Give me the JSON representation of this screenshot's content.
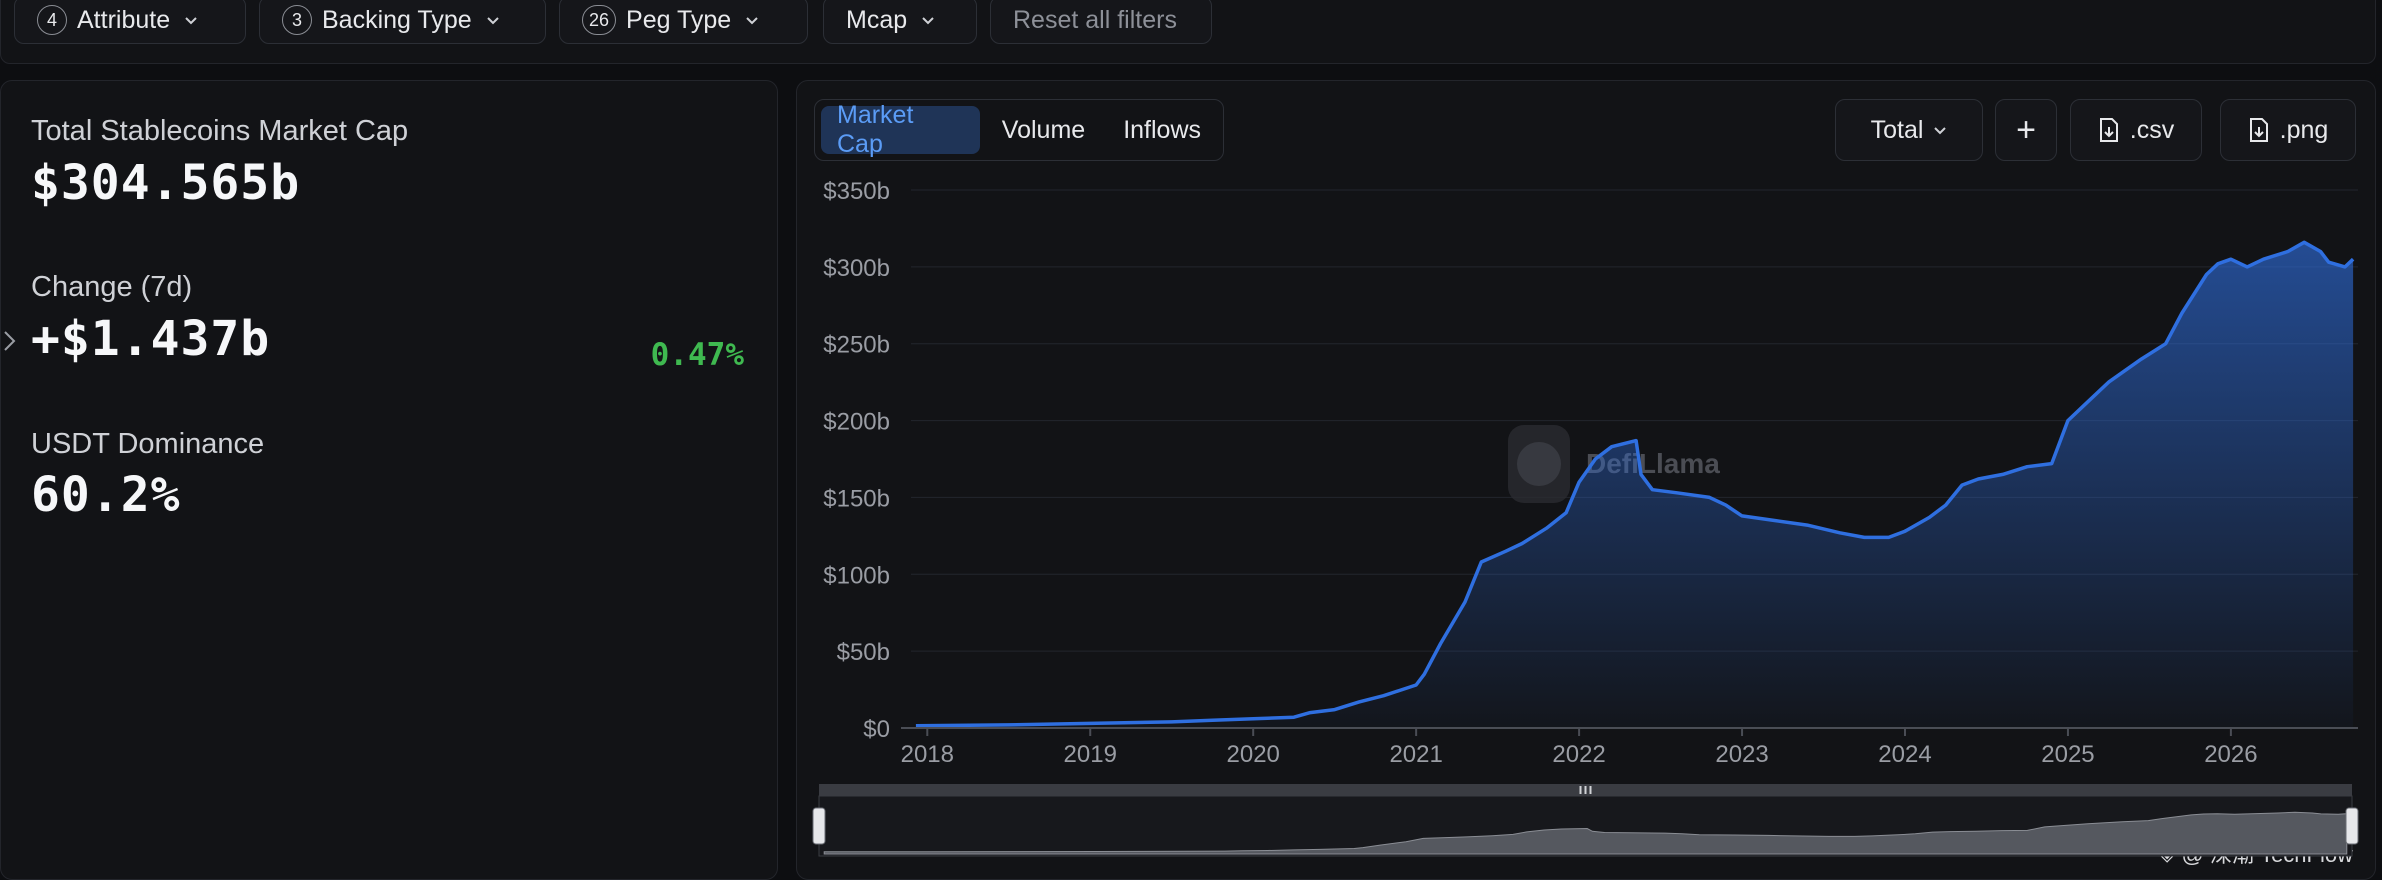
{
  "filters": [
    {
      "count": "4",
      "label": "Attribute"
    },
    {
      "count": "3",
      "label": "Backing Type"
    },
    {
      "count": "26",
      "label": "Peg Type"
    },
    {
      "count": "",
      "label": "Mcap"
    }
  ],
  "reset_label": "Reset all filters",
  "stats": {
    "total_label": "Total Stablecoins Market Cap",
    "total_value": "$304.565b",
    "change_label": "Change (7d)",
    "change_value": "+$1.437b",
    "change_pct": "0.47%",
    "dominance_label": "USDT Dominance",
    "dominance_value": "60.2%"
  },
  "tabs": [
    "Market Cap",
    "Volume",
    "Inflows"
  ],
  "active_tab": "Market Cap",
  "controls": {
    "total_select": "Total",
    "add_label": "+",
    "csv_label": ".csv",
    "png_label": ".png"
  },
  "watermark": "DefiLlama",
  "source_credit": "@ 深潮 TechFlow",
  "colors": {
    "accent": "#2f6fe0",
    "positive": "#3fb950",
    "background": "#121316"
  },
  "chart_data": {
    "type": "area",
    "title": "",
    "xlabel": "",
    "ylabel": "",
    "ylim": [
      0,
      350
    ],
    "y_unit": "b",
    "y_ticks": [
      "$0",
      "$50b",
      "$100b",
      "$150b",
      "$200b",
      "$250b",
      "$300b",
      "$350b"
    ],
    "x_ticks": [
      "2018",
      "2019",
      "2020",
      "2021",
      "2022",
      "2023",
      "2024",
      "2025",
      "2026"
    ],
    "grid": true,
    "series": [
      {
        "name": "",
        "points": [
          [
            2017.93,
            1.5
          ],
          [
            2018.5,
            2
          ],
          [
            2019.0,
            3
          ],
          [
            2019.5,
            4
          ],
          [
            2019.75,
            5
          ],
          [
            2020.0,
            6
          ],
          [
            2020.25,
            7
          ],
          [
            2020.35,
            10
          ],
          [
            2020.5,
            12
          ],
          [
            2020.65,
            17
          ],
          [
            2020.8,
            21
          ],
          [
            2021.0,
            28
          ],
          [
            2021.05,
            35
          ],
          [
            2021.15,
            55
          ],
          [
            2021.3,
            82
          ],
          [
            2021.4,
            108
          ],
          [
            2021.55,
            115
          ],
          [
            2021.65,
            120
          ],
          [
            2021.8,
            130
          ],
          [
            2021.92,
            140
          ],
          [
            2022.0,
            160
          ],
          [
            2022.1,
            175
          ],
          [
            2022.2,
            183
          ],
          [
            2022.35,
            187
          ],
          [
            2022.38,
            165
          ],
          [
            2022.45,
            155
          ],
          [
            2022.6,
            153
          ],
          [
            2022.8,
            150
          ],
          [
            2022.9,
            145
          ],
          [
            2023.0,
            138
          ],
          [
            2023.2,
            135
          ],
          [
            2023.4,
            132
          ],
          [
            2023.6,
            127
          ],
          [
            2023.75,
            124
          ],
          [
            2023.9,
            124
          ],
          [
            2024.0,
            128
          ],
          [
            2024.15,
            137
          ],
          [
            2024.25,
            145
          ],
          [
            2024.35,
            158
          ],
          [
            2024.45,
            162
          ],
          [
            2024.6,
            165
          ],
          [
            2024.75,
            170
          ],
          [
            2024.9,
            172
          ],
          [
            2025.0,
            200
          ],
          [
            2025.1,
            210
          ],
          [
            2025.25,
            225
          ],
          [
            2025.45,
            240
          ],
          [
            2025.6,
            250
          ],
          [
            2025.7,
            270
          ],
          [
            2025.85,
            295
          ],
          [
            2025.92,
            302
          ],
          [
            2026.0,
            305
          ],
          [
            2026.1,
            300
          ],
          [
            2026.2,
            305
          ],
          [
            2026.35,
            310
          ],
          [
            2026.45,
            316
          ],
          [
            2026.55,
            310
          ],
          [
            2026.6,
            303
          ],
          [
            2026.7,
            300
          ],
          [
            2026.75,
            305
          ]
        ]
      }
    ]
  }
}
